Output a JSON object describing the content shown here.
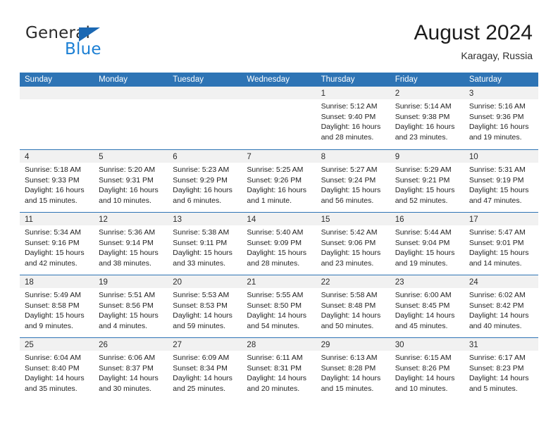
{
  "brand": {
    "name_part1": "General",
    "name_part2": "Blue",
    "triangle_color": "#1b68b3",
    "blue_color": "#1b7fd4"
  },
  "header": {
    "title": "August 2024",
    "subtitle": "Karagay, Russia"
  },
  "theme": {
    "header_blue": "#2e74b5",
    "day_band_gray": "#f1f1f1",
    "text_color": "#1f1f1f"
  },
  "weekdays": [
    "Sunday",
    "Monday",
    "Tuesday",
    "Wednesday",
    "Thursday",
    "Friday",
    "Saturday"
  ],
  "weeks": [
    [
      {
        "day": "",
        "sunrise": "",
        "sunset": "",
        "daylight_line1": "",
        "daylight_line2": ""
      },
      {
        "day": "",
        "sunrise": "",
        "sunset": "",
        "daylight_line1": "",
        "daylight_line2": ""
      },
      {
        "day": "",
        "sunrise": "",
        "sunset": "",
        "daylight_line1": "",
        "daylight_line2": ""
      },
      {
        "day": "",
        "sunrise": "",
        "sunset": "",
        "daylight_line1": "",
        "daylight_line2": ""
      },
      {
        "day": "1",
        "sunrise": "Sunrise: 5:12 AM",
        "sunset": "Sunset: 9:40 PM",
        "daylight_line1": "Daylight: 16 hours",
        "daylight_line2": "and 28 minutes."
      },
      {
        "day": "2",
        "sunrise": "Sunrise: 5:14 AM",
        "sunset": "Sunset: 9:38 PM",
        "daylight_line1": "Daylight: 16 hours",
        "daylight_line2": "and 23 minutes."
      },
      {
        "day": "3",
        "sunrise": "Sunrise: 5:16 AM",
        "sunset": "Sunset: 9:36 PM",
        "daylight_line1": "Daylight: 16 hours",
        "daylight_line2": "and 19 minutes."
      }
    ],
    [
      {
        "day": "4",
        "sunrise": "Sunrise: 5:18 AM",
        "sunset": "Sunset: 9:33 PM",
        "daylight_line1": "Daylight: 16 hours",
        "daylight_line2": "and 15 minutes."
      },
      {
        "day": "5",
        "sunrise": "Sunrise: 5:20 AM",
        "sunset": "Sunset: 9:31 PM",
        "daylight_line1": "Daylight: 16 hours",
        "daylight_line2": "and 10 minutes."
      },
      {
        "day": "6",
        "sunrise": "Sunrise: 5:23 AM",
        "sunset": "Sunset: 9:29 PM",
        "daylight_line1": "Daylight: 16 hours",
        "daylight_line2": "and 6 minutes."
      },
      {
        "day": "7",
        "sunrise": "Sunrise: 5:25 AM",
        "sunset": "Sunset: 9:26 PM",
        "daylight_line1": "Daylight: 16 hours",
        "daylight_line2": "and 1 minute."
      },
      {
        "day": "8",
        "sunrise": "Sunrise: 5:27 AM",
        "sunset": "Sunset: 9:24 PM",
        "daylight_line1": "Daylight: 15 hours",
        "daylight_line2": "and 56 minutes."
      },
      {
        "day": "9",
        "sunrise": "Sunrise: 5:29 AM",
        "sunset": "Sunset: 9:21 PM",
        "daylight_line1": "Daylight: 15 hours",
        "daylight_line2": "and 52 minutes."
      },
      {
        "day": "10",
        "sunrise": "Sunrise: 5:31 AM",
        "sunset": "Sunset: 9:19 PM",
        "daylight_line1": "Daylight: 15 hours",
        "daylight_line2": "and 47 minutes."
      }
    ],
    [
      {
        "day": "11",
        "sunrise": "Sunrise: 5:34 AM",
        "sunset": "Sunset: 9:16 PM",
        "daylight_line1": "Daylight: 15 hours",
        "daylight_line2": "and 42 minutes."
      },
      {
        "day": "12",
        "sunrise": "Sunrise: 5:36 AM",
        "sunset": "Sunset: 9:14 PM",
        "daylight_line1": "Daylight: 15 hours",
        "daylight_line2": "and 38 minutes."
      },
      {
        "day": "13",
        "sunrise": "Sunrise: 5:38 AM",
        "sunset": "Sunset: 9:11 PM",
        "daylight_line1": "Daylight: 15 hours",
        "daylight_line2": "and 33 minutes."
      },
      {
        "day": "14",
        "sunrise": "Sunrise: 5:40 AM",
        "sunset": "Sunset: 9:09 PM",
        "daylight_line1": "Daylight: 15 hours",
        "daylight_line2": "and 28 minutes."
      },
      {
        "day": "15",
        "sunrise": "Sunrise: 5:42 AM",
        "sunset": "Sunset: 9:06 PM",
        "daylight_line1": "Daylight: 15 hours",
        "daylight_line2": "and 23 minutes."
      },
      {
        "day": "16",
        "sunrise": "Sunrise: 5:44 AM",
        "sunset": "Sunset: 9:04 PM",
        "daylight_line1": "Daylight: 15 hours",
        "daylight_line2": "and 19 minutes."
      },
      {
        "day": "17",
        "sunrise": "Sunrise: 5:47 AM",
        "sunset": "Sunset: 9:01 PM",
        "daylight_line1": "Daylight: 15 hours",
        "daylight_line2": "and 14 minutes."
      }
    ],
    [
      {
        "day": "18",
        "sunrise": "Sunrise: 5:49 AM",
        "sunset": "Sunset: 8:58 PM",
        "daylight_line1": "Daylight: 15 hours",
        "daylight_line2": "and 9 minutes."
      },
      {
        "day": "19",
        "sunrise": "Sunrise: 5:51 AM",
        "sunset": "Sunset: 8:56 PM",
        "daylight_line1": "Daylight: 15 hours",
        "daylight_line2": "and 4 minutes."
      },
      {
        "day": "20",
        "sunrise": "Sunrise: 5:53 AM",
        "sunset": "Sunset: 8:53 PM",
        "daylight_line1": "Daylight: 14 hours",
        "daylight_line2": "and 59 minutes."
      },
      {
        "day": "21",
        "sunrise": "Sunrise: 5:55 AM",
        "sunset": "Sunset: 8:50 PM",
        "daylight_line1": "Daylight: 14 hours",
        "daylight_line2": "and 54 minutes."
      },
      {
        "day": "22",
        "sunrise": "Sunrise: 5:58 AM",
        "sunset": "Sunset: 8:48 PM",
        "daylight_line1": "Daylight: 14 hours",
        "daylight_line2": "and 50 minutes."
      },
      {
        "day": "23",
        "sunrise": "Sunrise: 6:00 AM",
        "sunset": "Sunset: 8:45 PM",
        "daylight_line1": "Daylight: 14 hours",
        "daylight_line2": "and 45 minutes."
      },
      {
        "day": "24",
        "sunrise": "Sunrise: 6:02 AM",
        "sunset": "Sunset: 8:42 PM",
        "daylight_line1": "Daylight: 14 hours",
        "daylight_line2": "and 40 minutes."
      }
    ],
    [
      {
        "day": "25",
        "sunrise": "Sunrise: 6:04 AM",
        "sunset": "Sunset: 8:40 PM",
        "daylight_line1": "Daylight: 14 hours",
        "daylight_line2": "and 35 minutes."
      },
      {
        "day": "26",
        "sunrise": "Sunrise: 6:06 AM",
        "sunset": "Sunset: 8:37 PM",
        "daylight_line1": "Daylight: 14 hours",
        "daylight_line2": "and 30 minutes."
      },
      {
        "day": "27",
        "sunrise": "Sunrise: 6:09 AM",
        "sunset": "Sunset: 8:34 PM",
        "daylight_line1": "Daylight: 14 hours",
        "daylight_line2": "and 25 minutes."
      },
      {
        "day": "28",
        "sunrise": "Sunrise: 6:11 AM",
        "sunset": "Sunset: 8:31 PM",
        "daylight_line1": "Daylight: 14 hours",
        "daylight_line2": "and 20 minutes."
      },
      {
        "day": "29",
        "sunrise": "Sunrise: 6:13 AM",
        "sunset": "Sunset: 8:28 PM",
        "daylight_line1": "Daylight: 14 hours",
        "daylight_line2": "and 15 minutes."
      },
      {
        "day": "30",
        "sunrise": "Sunrise: 6:15 AM",
        "sunset": "Sunset: 8:26 PM",
        "daylight_line1": "Daylight: 14 hours",
        "daylight_line2": "and 10 minutes."
      },
      {
        "day": "31",
        "sunrise": "Sunrise: 6:17 AM",
        "sunset": "Sunset: 8:23 PM",
        "daylight_line1": "Daylight: 14 hours",
        "daylight_line2": "and 5 minutes."
      }
    ]
  ]
}
